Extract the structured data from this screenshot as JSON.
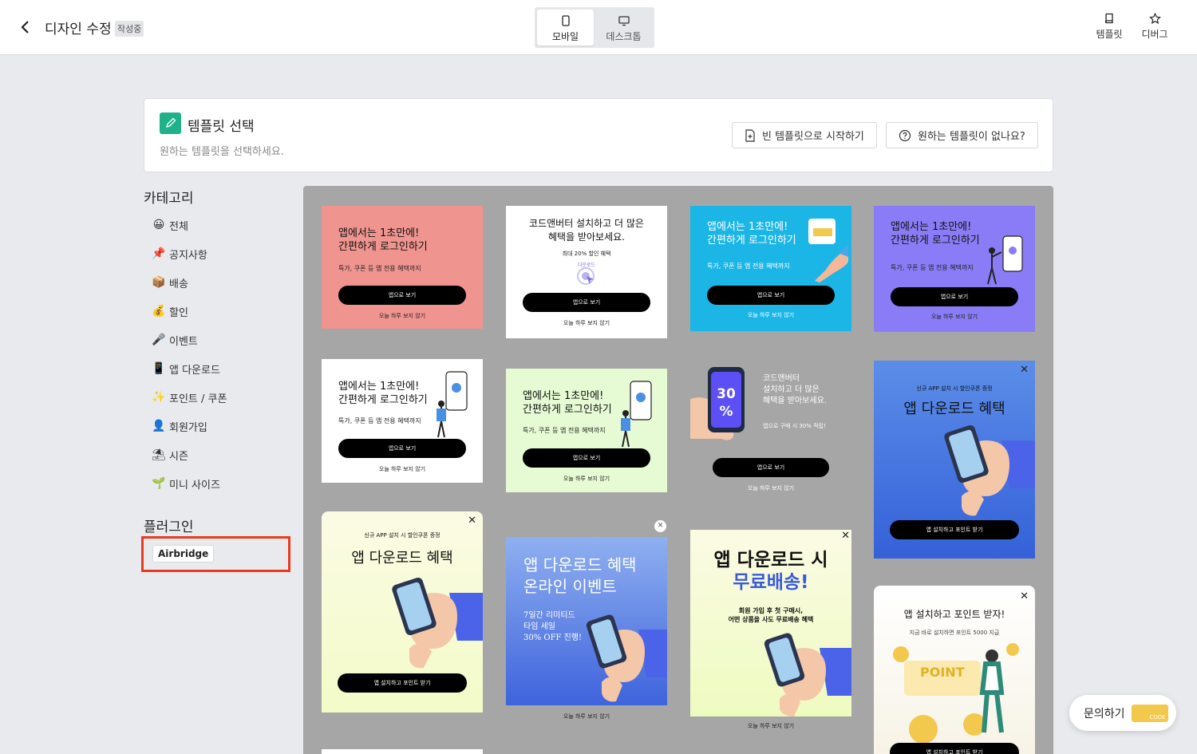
{
  "header": {
    "title": "디자인 수정",
    "status": "작성중",
    "modes": [
      "모바일",
      "데스크톱"
    ],
    "right": [
      "템플릿",
      "디버그"
    ]
  },
  "panel": {
    "title": "템플릿 선택",
    "subtitle": "원하는 템플릿을 선택하세요.",
    "blank_btn": "빈 템플릿으로 시작하기",
    "missing_btn": "원하는 템플릿이 없나요?"
  },
  "sidebar": {
    "category_title": "카테고리",
    "categories": [
      {
        "emoji": "😀",
        "label": "전체"
      },
      {
        "emoji": "📌",
        "label": "공지사항"
      },
      {
        "emoji": "📦",
        "label": "배송"
      },
      {
        "emoji": "💰",
        "label": "할인"
      },
      {
        "emoji": "🎤",
        "label": "이벤트"
      },
      {
        "emoji": "📱",
        "label": "앱 다운로드"
      },
      {
        "emoji": "✨",
        "label": "포인트 / 쿠폰"
      },
      {
        "emoji": "👤",
        "label": "회원가입"
      },
      {
        "emoji": "⛱",
        "label": "시즌"
      },
      {
        "emoji": "🌱",
        "label": "미니 사이즈"
      }
    ],
    "plugin_title": "플러그인",
    "plugins": [
      "Airbridge"
    ]
  },
  "cards": {
    "c1": {
      "title": "앱에서는 1초만에!\n간편하게 로그인하기",
      "sub": "특가, 쿠폰 등 앱 전용 혜택까지",
      "btn": "앱으로 보기",
      "link": "오늘 하루 보지 않기"
    },
    "c2": {
      "title": "코드앤버터 설치하고 더 많은\n혜택을 받아보세요.",
      "sub": "최대 20% 할인 혜택",
      "badge": "다운로드",
      "btn": "앱으로 보기",
      "link": "오늘 하루 보지 않기"
    },
    "c3": {
      "title": "앱에서는 1초만에!\n간편하게 로그인하기",
      "sub": "특가, 쿠폰 등 앱 전용 혜택까지",
      "btn": "앱으로 보기",
      "link": "오늘 하루 보지 않기"
    },
    "c4": {
      "title": "앱에서는 1초만에!\n간편하게 로그인하기",
      "sub": "특가, 쿠폰 등 앱 전용 혜택까지",
      "btn": "앱으로 보기",
      "link": "오늘 하루 보지 않기"
    },
    "c5": {
      "title": "앱에서는 1초만에!\n간편하게 로그인하기",
      "sub": "특가, 쿠폰 등 앱 전용 혜택까지",
      "btn": "앱으로 보기",
      "link": "오늘 하루 보지 않기"
    },
    "c6": {
      "title": "앱에서는 1초만에!\n간편하게 로그인하기",
      "sub": "특가, 쿠폰 등 앱 전용 혜택까지",
      "btn": "앱으로 보기",
      "link": "오늘 하루 보지 않기"
    },
    "c7": {
      "phone_num": "30",
      "phone_pct": "%",
      "title": "코드앤버터\n설치하고 더 많은\n혜택을 받아보세요.",
      "sub": "앱으로 구매 시 30% 적립!",
      "btn": "앱으로 보기",
      "link": "오늘 하루 보지 않기"
    },
    "c8": {
      "kicker": "신규 APP 설치 시 할인쿠폰 증정",
      "title": "앱 다운로드 혜택",
      "btn": "앱 설치하고 포인트 받기"
    },
    "c9": {
      "kicker": "신규 APP 설치 시 할인쿠폰 증정",
      "title": "앱 다운로드 혜택",
      "btn": "앱 설치하고 포인트 받기"
    },
    "c10": {
      "title": "앱 다운로드 혜택\n온라인 이벤트",
      "sub": "7일간 리미티드\n타임 세일\n30% OFF 진행!",
      "link": "오늘 하루 보지 않기"
    },
    "c11": {
      "title1": "앱 다운로드 시",
      "title2": "무료배송!",
      "sub": "회원 가입 후 첫 구매시,\n어떤 상품을 사도 무료배송 혜택",
      "link": "오늘 하루 보지 않기"
    },
    "c12": {
      "title": "앱 설치하고 포인트 받자!",
      "sub": "지금 바로 설치하면 포인트 5000 지급",
      "point": "POINT",
      "btn": "앱 설치하고 포인트 받기"
    }
  },
  "inquiry": {
    "label": "문의하기",
    "coupon": "CODE"
  },
  "colors": {
    "accent": "#1fb28a",
    "highlight": "#e83b1f"
  }
}
